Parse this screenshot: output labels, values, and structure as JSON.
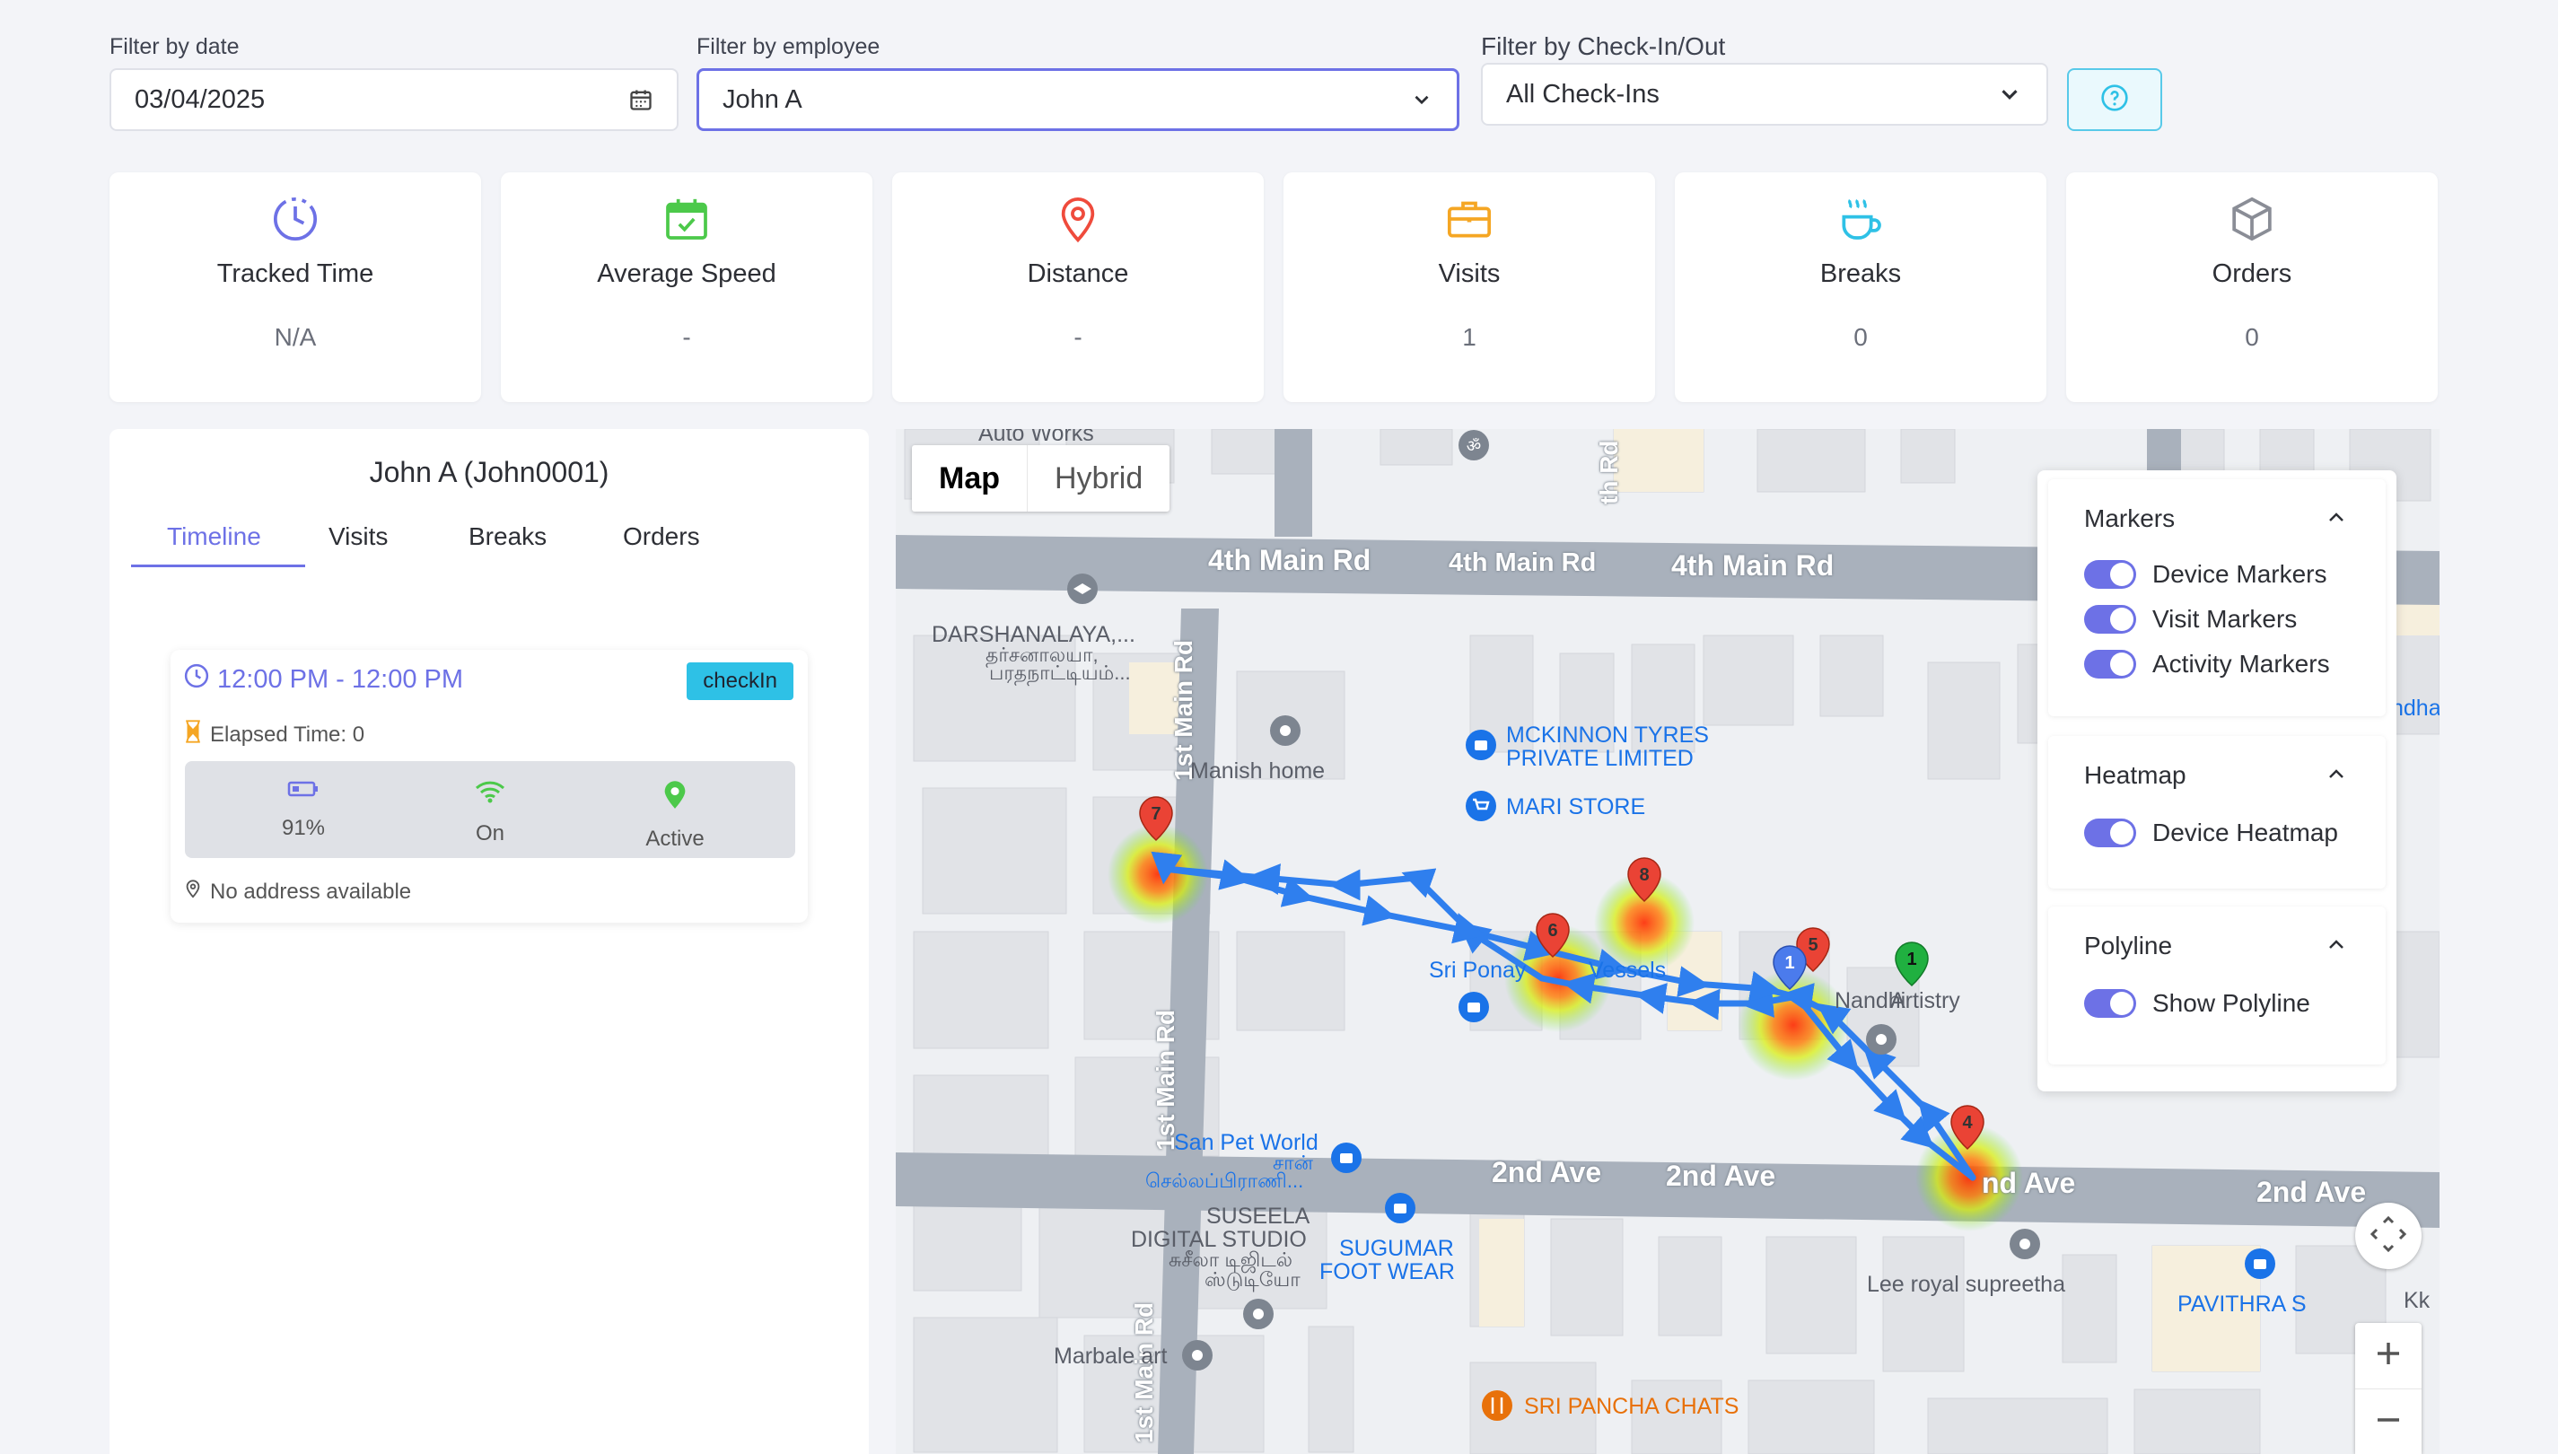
{
  "filters": {
    "date": {
      "label": "Filter by date",
      "value": "03/04/2025"
    },
    "employee": {
      "label": "Filter by employee",
      "value": "John A"
    },
    "checkin": {
      "label": "Filter by Check-In/Out",
      "value": "All Check-Ins"
    }
  },
  "stats": [
    {
      "title": "Tracked Time",
      "value": "N/A",
      "icon": "clock-icon",
      "color": "#6d71e6"
    },
    {
      "title": "Average Speed",
      "value": "-",
      "icon": "calendar-check-icon",
      "color": "#4cc94a"
    },
    {
      "title": "Distance",
      "value": "-",
      "icon": "map-pin-icon",
      "color": "#ef4b3c"
    },
    {
      "title": "Visits",
      "value": "1",
      "icon": "briefcase-icon",
      "color": "#f5a623"
    },
    {
      "title": "Breaks",
      "value": "0",
      "icon": "coffee-cup-icon",
      "color": "#2ec1e6"
    },
    {
      "title": "Orders",
      "value": "0",
      "icon": "box-icon",
      "color": "#8a8d96"
    }
  ],
  "employee_panel": {
    "name": "John A (John0001)",
    "tabs": [
      "Timeline",
      "Visits",
      "Breaks",
      "Orders"
    ],
    "active_tab": "Timeline",
    "timeline": {
      "time_range": "12:00 PM - 12:00 PM",
      "badge": "checkIn",
      "elapsed": "Elapsed Time: 0",
      "battery": "91%",
      "wifi": "On",
      "gps": "Active",
      "address": "No address available"
    }
  },
  "map": {
    "type_options": [
      "Map",
      "Hybrid"
    ],
    "active_type": "Map",
    "roads": {
      "r4a": "4th Main Rd",
      "r4b": "4th Main Rd",
      "r4c": "4th Main Rd",
      "r1a": "1st Main Rd",
      "r1b": "1st Main Rd",
      "r1c": "1st Main Rd",
      "r2a": "2nd Ave",
      "r2b": "2nd Ave",
      "r2c": "nd Ave",
      "r2d": "2nd Ave",
      "rth": "th Rd"
    },
    "places": {
      "auto_works": "Auto Works",
      "darshanalaya_1": "DARSHANALAYA,...",
      "darshanalaya_2": "தர்சனாலயா,",
      "darshanalaya_3": "பரதநாட்டியம்...",
      "manish_home": "Manish home",
      "mckinnon_1": "MCKINNON TYRES",
      "mckinnon_2": "PRIVATE LIMITED",
      "mari_store": "MARI STORE",
      "sri_ponay": "Sri Ponay",
      "vessels": "Vessels",
      "nandhini": "Nandhi",
      "artistry": "Artistry",
      "san_pet_1": "San Pet World",
      "san_pet_2": "சான்",
      "san_pet_3": "செல்லப்பிராணி...",
      "suseela_1": "SUSEELA",
      "suseela_2": "DIGITAL STUDIO",
      "suseela_3": "சுசீலா டிஜிடல்",
      "suseela_4": "ஸ்டுடியோ",
      "sugumar_1": "SUGUMAR",
      "sugumar_2": "FOOT WEAR",
      "marbale": "Marbale art",
      "lee_royal": "Lee royal supreetha",
      "pavithra": "PAVITHRA S",
      "sri_pancha": "SRI PANCHA CHATS",
      "ndha": "ndha",
      "kk": "Kk"
    },
    "markers": [
      "1",
      "4",
      "5",
      "6",
      "7",
      "8",
      "1"
    ],
    "layers": {
      "markers": {
        "title": "Markers",
        "items": [
          "Device Markers",
          "Visit Markers",
          "Activity Markers"
        ]
      },
      "heatmap": {
        "title": "Heatmap",
        "items": [
          "Device Heatmap"
        ]
      },
      "polyline": {
        "title": "Polyline",
        "items": [
          "Show Polyline"
        ]
      }
    }
  }
}
